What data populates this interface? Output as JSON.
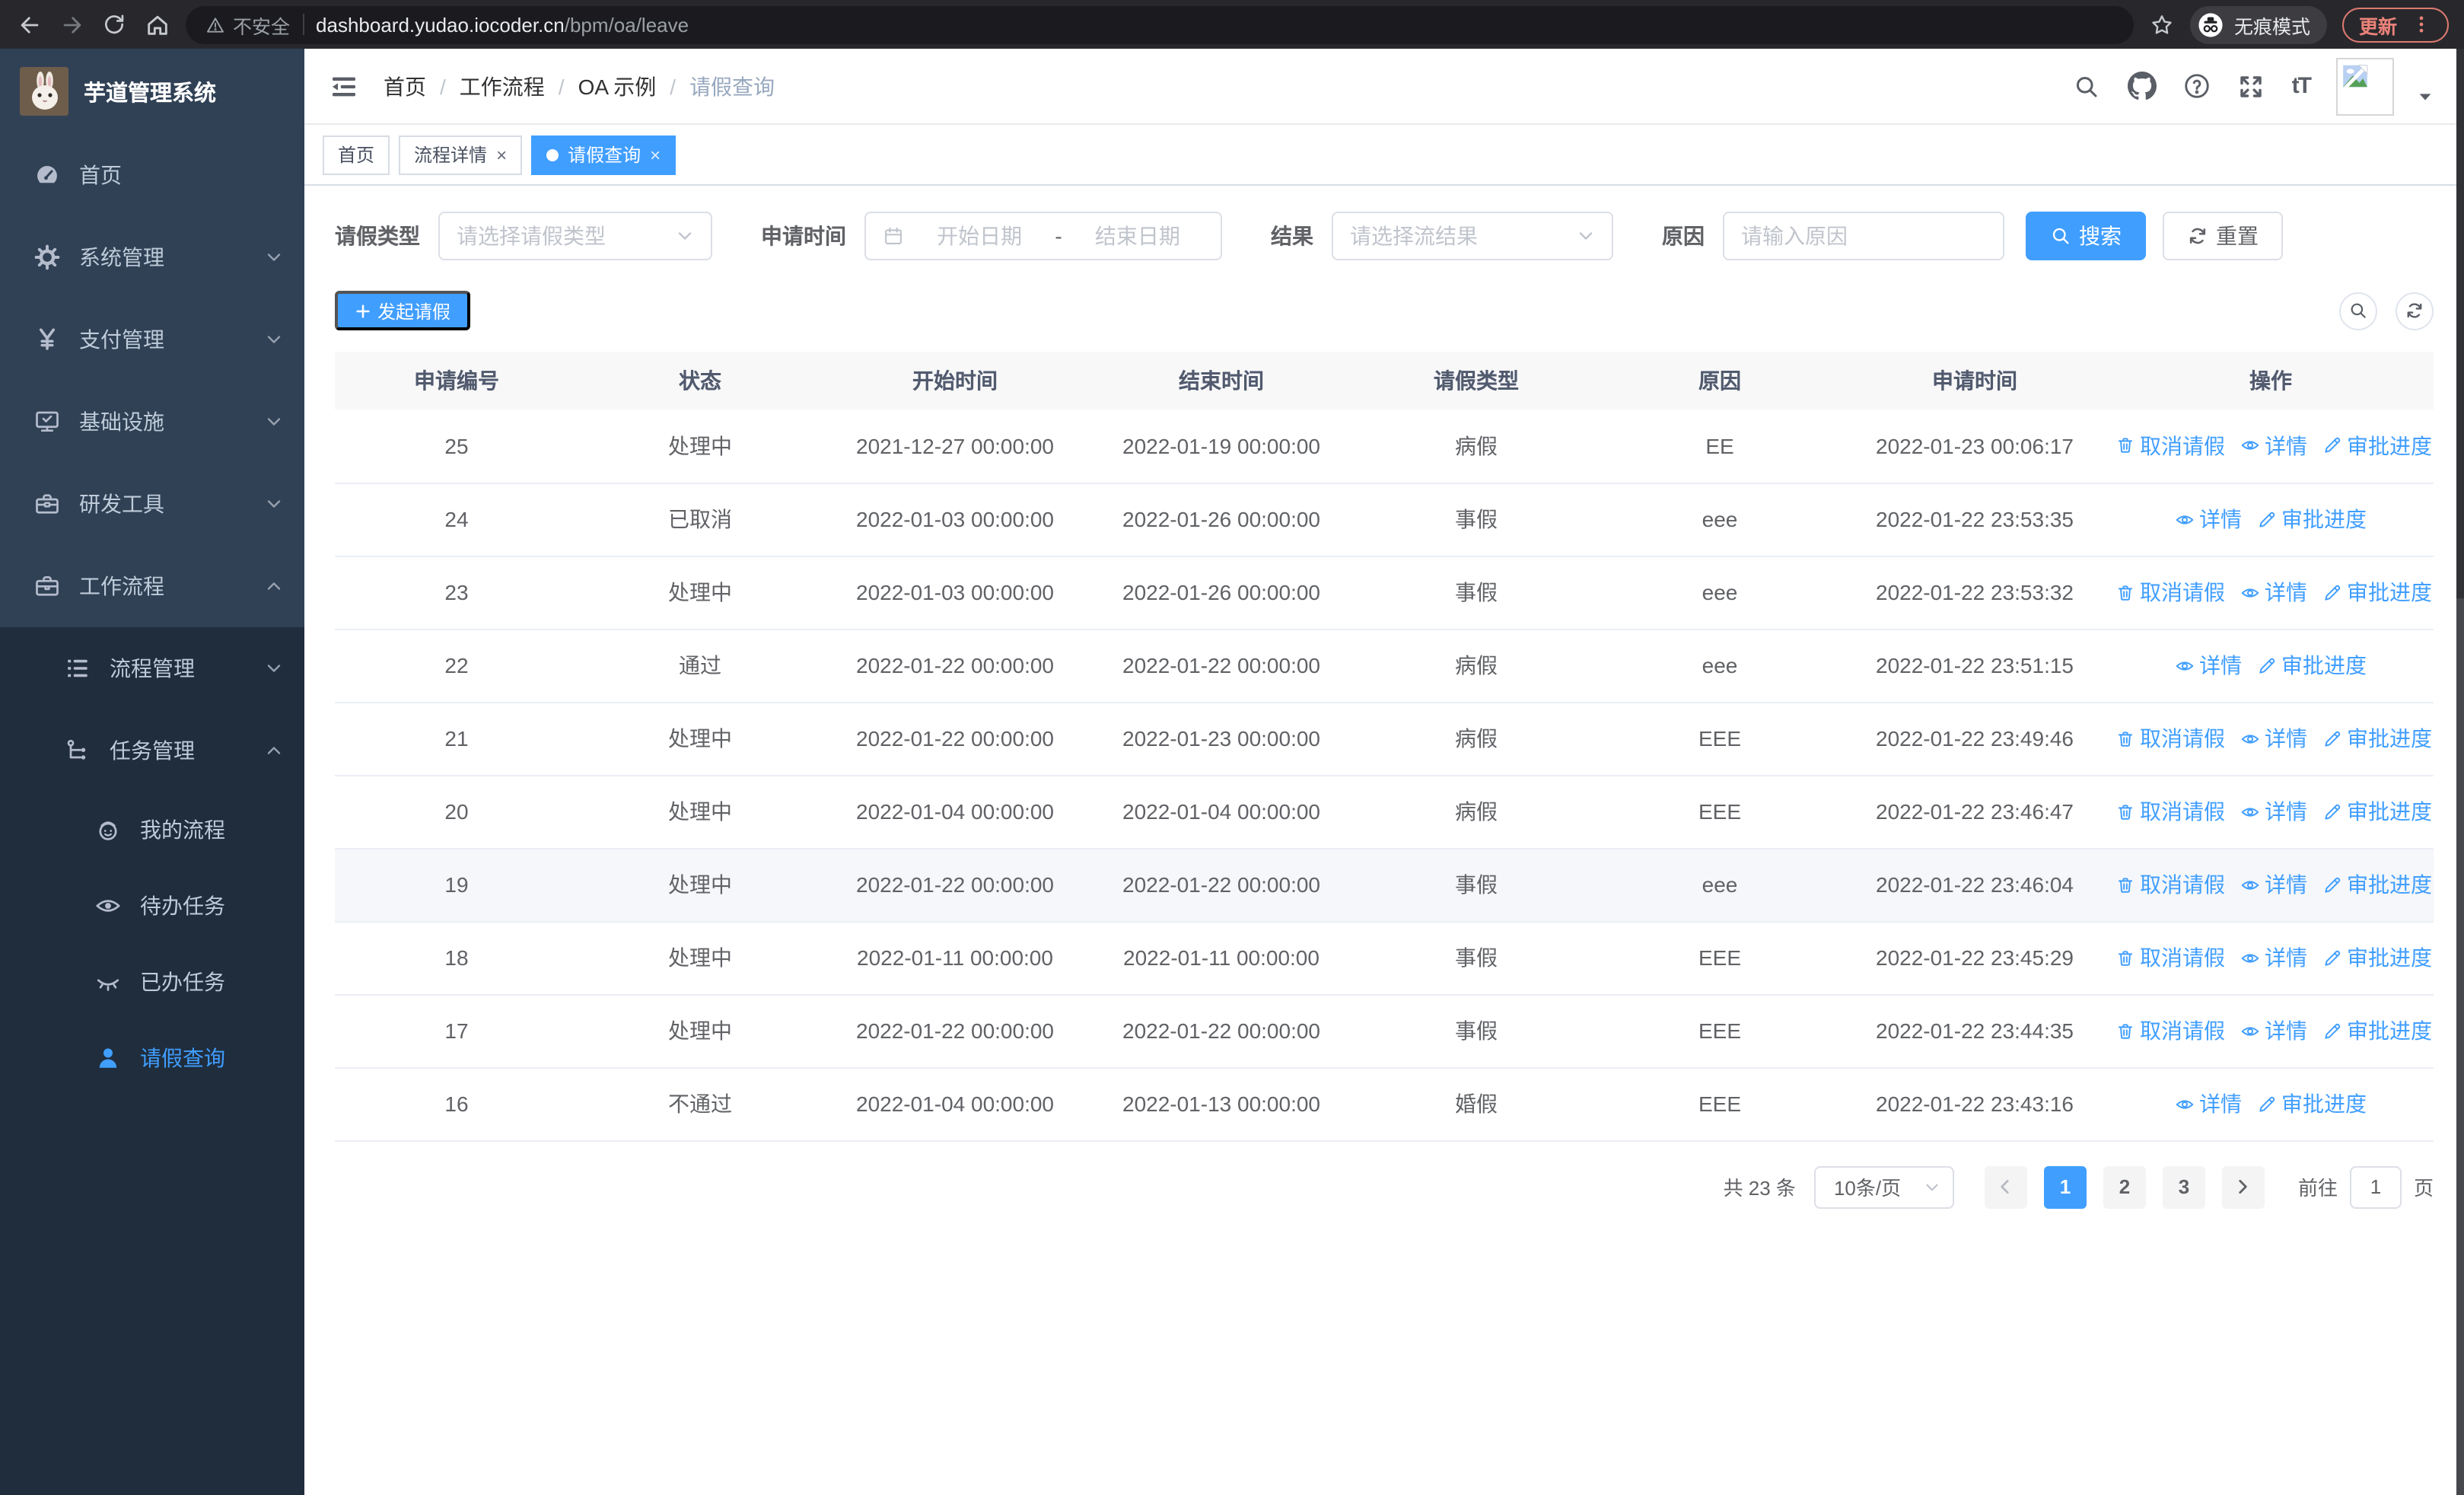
{
  "browser": {
    "security_label": "不安全",
    "url_host": "dashboard.yudao.iocoder.cn",
    "url_path": "/bpm/oa/leave",
    "incognito_label": "无痕模式",
    "update_label": "更新"
  },
  "sidebar": {
    "app_title": "芋道管理系统",
    "items": [
      {
        "name": "home",
        "label": "首页",
        "icon": "dashboard-icon",
        "level": 1
      },
      {
        "name": "system-management",
        "label": "系统管理",
        "icon": "gear-icon",
        "level": 1,
        "arrow": "down"
      },
      {
        "name": "payment-management",
        "label": "支付管理",
        "icon": "yen-icon",
        "level": 1,
        "arrow": "down"
      },
      {
        "name": "infrastructure",
        "label": "基础设施",
        "icon": "monitor-icon",
        "level": 1,
        "arrow": "down"
      },
      {
        "name": "dev-tools",
        "label": "研发工具",
        "icon": "toolbox-icon",
        "level": 1,
        "arrow": "down"
      },
      {
        "name": "workflow",
        "label": "工作流程",
        "icon": "briefcase-icon",
        "level": 1,
        "arrow": "up"
      },
      {
        "name": "process-management",
        "label": "流程管理",
        "icon": "list-icon",
        "level": 2,
        "arrow": "down"
      },
      {
        "name": "task-management",
        "label": "任务管理",
        "icon": "tree-icon",
        "level": 2,
        "arrow": "up"
      },
      {
        "name": "my-processes",
        "label": "我的流程",
        "icon": "face-icon",
        "level": 3
      },
      {
        "name": "todo-tasks",
        "label": "待办任务",
        "icon": "eye-open-icon",
        "level": 3
      },
      {
        "name": "done-tasks",
        "label": "已办任务",
        "icon": "eye-closed-icon",
        "level": 3
      },
      {
        "name": "leave-query",
        "label": "请假查询",
        "icon": "user-icon",
        "level": 3,
        "active": true
      }
    ]
  },
  "breadcrumb": [
    "首页",
    "工作流程",
    "OA 示例",
    "请假查询"
  ],
  "tabs": [
    {
      "label": "首页",
      "closable": false,
      "active": false
    },
    {
      "label": "流程详情",
      "closable": true,
      "active": false
    },
    {
      "label": "请假查询",
      "closable": true,
      "active": true
    }
  ],
  "filters": {
    "type_label": "请假类型",
    "type_placeholder": "请选择请假类型",
    "time_label": "申请时间",
    "start_placeholder": "开始日期",
    "range_separator": "-",
    "end_placeholder": "结束日期",
    "result_label": "结果",
    "result_placeholder": "请选择流结果",
    "reason_label": "原因",
    "reason_placeholder": "请输入原因",
    "search_label": "搜索",
    "reset_label": "重置"
  },
  "toolbar": {
    "create_label": "发起请假"
  },
  "table": {
    "headers": [
      "申请编号",
      "状态",
      "开始时间",
      "结束时间",
      "请假类型",
      "原因",
      "申请时间",
      "操作"
    ],
    "action_labels": {
      "cancel": "取消请假",
      "detail": "详情",
      "progress": "审批进度"
    },
    "rows": [
      {
        "id": "25",
        "status": "处理中",
        "start": "2021-12-27 00:00:00",
        "end": "2022-01-19 00:00:00",
        "type": "病假",
        "reason": "EE",
        "applied": "2022-01-23 00:06:17",
        "actions": [
          "cancel",
          "detail",
          "progress"
        ]
      },
      {
        "id": "24",
        "status": "已取消",
        "start": "2022-01-03 00:00:00",
        "end": "2022-01-26 00:00:00",
        "type": "事假",
        "reason": "eee",
        "applied": "2022-01-22 23:53:35",
        "actions": [
          "detail",
          "progress"
        ]
      },
      {
        "id": "23",
        "status": "处理中",
        "start": "2022-01-03 00:00:00",
        "end": "2022-01-26 00:00:00",
        "type": "事假",
        "reason": "eee",
        "applied": "2022-01-22 23:53:32",
        "actions": [
          "cancel",
          "detail",
          "progress"
        ]
      },
      {
        "id": "22",
        "status": "通过",
        "start": "2022-01-22 00:00:00",
        "end": "2022-01-22 00:00:00",
        "type": "病假",
        "reason": "eee",
        "applied": "2022-01-22 23:51:15",
        "actions": [
          "detail",
          "progress"
        ]
      },
      {
        "id": "21",
        "status": "处理中",
        "start": "2022-01-22 00:00:00",
        "end": "2022-01-23 00:00:00",
        "type": "病假",
        "reason": "EEE",
        "applied": "2022-01-22 23:49:46",
        "actions": [
          "cancel",
          "detail",
          "progress"
        ]
      },
      {
        "id": "20",
        "status": "处理中",
        "start": "2022-01-04 00:00:00",
        "end": "2022-01-04 00:00:00",
        "type": "病假",
        "reason": "EEE",
        "applied": "2022-01-22 23:46:47",
        "actions": [
          "cancel",
          "detail",
          "progress"
        ]
      },
      {
        "id": "19",
        "status": "处理中",
        "start": "2022-01-22 00:00:00",
        "end": "2022-01-22 00:00:00",
        "type": "事假",
        "reason": "eee",
        "applied": "2022-01-22 23:46:04",
        "actions": [
          "cancel",
          "detail",
          "progress"
        ],
        "hover": true
      },
      {
        "id": "18",
        "status": "处理中",
        "start": "2022-01-11 00:00:00",
        "end": "2022-01-11 00:00:00",
        "type": "事假",
        "reason": "EEE",
        "applied": "2022-01-22 23:45:29",
        "actions": [
          "cancel",
          "detail",
          "progress"
        ]
      },
      {
        "id": "17",
        "status": "处理中",
        "start": "2022-01-22 00:00:00",
        "end": "2022-01-22 00:00:00",
        "type": "事假",
        "reason": "EEE",
        "applied": "2022-01-22 23:44:35",
        "actions": [
          "cancel",
          "detail",
          "progress"
        ]
      },
      {
        "id": "16",
        "status": "不通过",
        "start": "2022-01-04 00:00:00",
        "end": "2022-01-13 00:00:00",
        "type": "婚假",
        "reason": "EEE",
        "applied": "2022-01-22 23:43:16",
        "actions": [
          "detail",
          "progress"
        ]
      }
    ]
  },
  "pagination": {
    "total_label": "共 23 条",
    "page_size": "10条/页",
    "pages": [
      "1",
      "2",
      "3"
    ],
    "current": "1",
    "goto_label": "前往",
    "goto_value": "1",
    "unit_label": "页"
  },
  "colors": {
    "accent": "#409eff",
    "sidebar_bg": "#304156",
    "submenu_bg": "#1f2d3d",
    "update_red": "#e77c73"
  }
}
